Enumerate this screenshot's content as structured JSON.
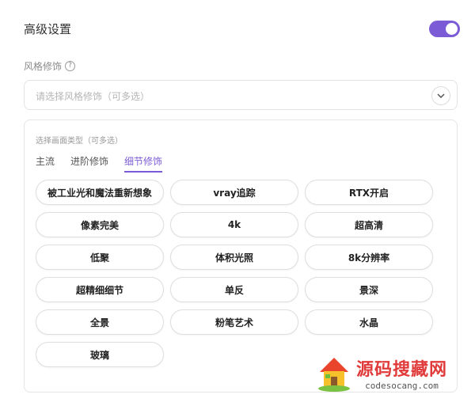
{
  "advanced": {
    "title": "高级设置",
    "toggle_on": true
  },
  "style": {
    "label": "风格修饰",
    "help_icon": "question-circle-icon",
    "placeholder": "请选择风格修饰（可多选）",
    "dropdown_icon": "chevron-down-icon"
  },
  "panel": {
    "title": "选择画面类型（可多选）",
    "tabs": [
      {
        "label": "主流",
        "active": false
      },
      {
        "label": "进阶修饰",
        "active": false
      },
      {
        "label": "细节修饰",
        "active": true
      }
    ],
    "options": [
      "被工业光和魔法重新想象",
      "vray追踪",
      "RTX开启",
      "像素完美",
      "4k",
      "超高清",
      "低聚",
      "体积光照",
      "8k分辨率",
      "超精细细节",
      "单反",
      "景深",
      "全景",
      "粉笔艺术",
      "水晶",
      "玻璃"
    ]
  },
  "watermark": {
    "title": "源码搜藏网",
    "url": "codesocang.com"
  },
  "colors": {
    "accent": "#7c5cd6",
    "watermark_red": "#e03a3a"
  }
}
